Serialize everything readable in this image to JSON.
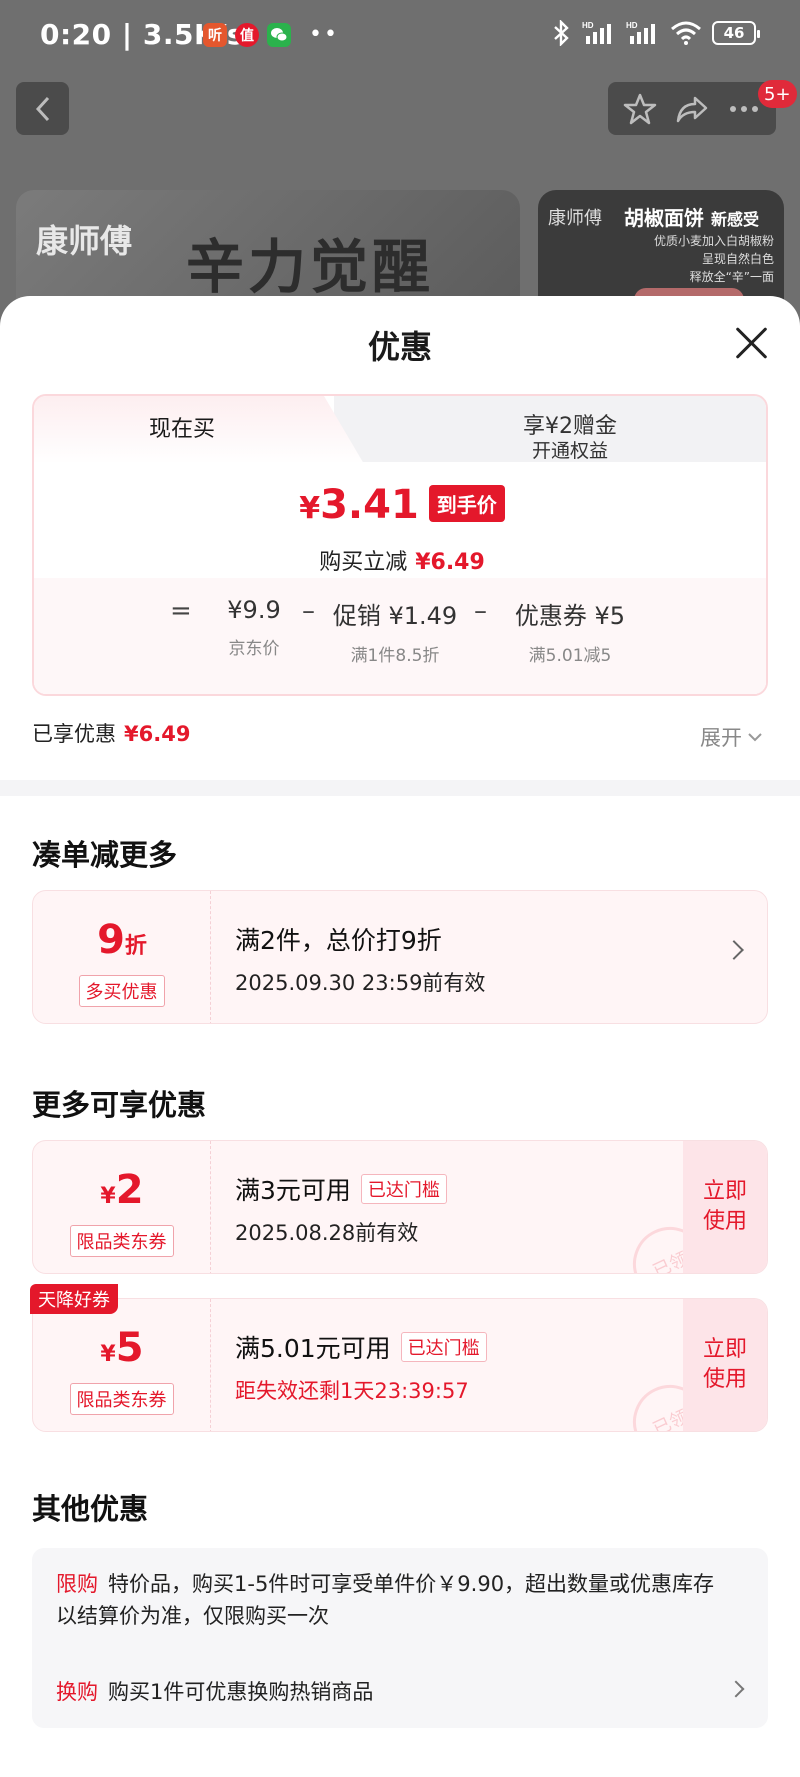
{
  "status_bar": {
    "time": "0:20",
    "net_speed": "3.5K/s",
    "battery": "46",
    "app_icons": [
      "ting-icon",
      "zhi-icon",
      "wechat-icon"
    ]
  },
  "header": {
    "cart_badge": "5+"
  },
  "banner": {
    "brand": "康师傅",
    "headline": "辛力觉醒",
    "side_title": "胡椒面饼",
    "side_tag": "新感受",
    "side_lines": [
      "优质小麦加入白胡椒粉",
      "呈现自然白色",
      "释放全“辛”一面"
    ]
  },
  "sheet": {
    "title": "优惠"
  },
  "price_card": {
    "tab_left": "现在买",
    "tab_right_line1": "享¥2赠金",
    "tab_right_line2": "开通权益",
    "currency": "¥",
    "final_price": "3.41",
    "final_tag": "到手价",
    "instant_label": "购买立减",
    "instant_value": "¥6.49",
    "eq": "=",
    "op1": "–",
    "op2": "–",
    "jd_price": "¥9.9",
    "jd_price_label": "京东价",
    "promo": "促销 ¥1.49",
    "promo_label": "满1件8.5折",
    "coupon": "优惠券 ¥5",
    "coupon_label": "满5.01减5"
  },
  "saved": {
    "label": "已享优惠",
    "value": "¥6.49",
    "expand": "展开"
  },
  "section_more": {
    "title": "凑单减更多",
    "card": {
      "amount": "9",
      "unit": "折",
      "tag": "多买优惠",
      "line1": "满2件，总价打9折",
      "line2": "2025.09.30 23:59前有效"
    }
  },
  "section_coupons": {
    "title": "更多可享优惠",
    "coupons": [
      {
        "currency": "¥",
        "amount": "2",
        "tag": "限品类东券",
        "line1": "满3元可用",
        "met": "已达门槛",
        "line2": "2025.08.28前有效",
        "button": "立即使用",
        "stamp": "已领"
      },
      {
        "badge": "天降好券",
        "currency": "¥",
        "amount": "5",
        "tag": "限品类东券",
        "line1": "满5.01元可用",
        "met": "已达门槛",
        "line2": "距失效还剩1天23:39:57",
        "button": "立即使用",
        "stamp": "已领"
      }
    ]
  },
  "section_other": {
    "title": "其他优惠",
    "items": [
      {
        "key": "限购",
        "text": "特价品，购买1-5件时可享受单件价￥9.90，超出数量或优惠库存以结算价为准，仅限购买一次"
      },
      {
        "key": "换购",
        "text": "购买1件可优惠换购热销商品"
      }
    ]
  },
  "colors": {
    "accent": "#e4182b",
    "overlay": "#6f6f6f",
    "card_bg": "#fff5f6"
  }
}
